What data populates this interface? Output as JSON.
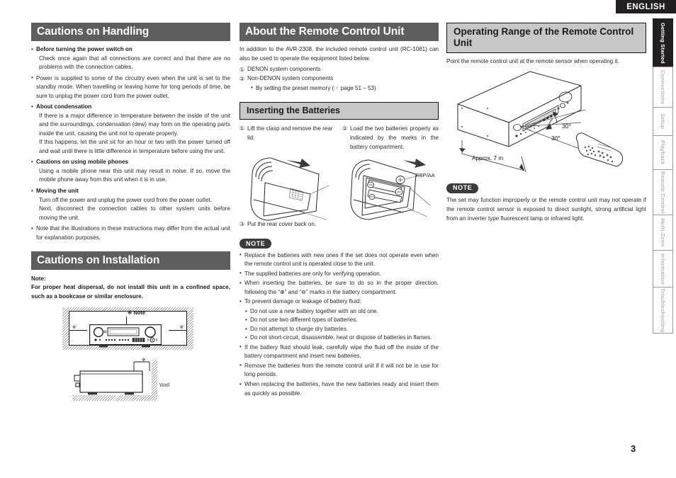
{
  "language_badge": "ENGLISH",
  "page_number": "3",
  "colors": {
    "heading_dark_bg": "#5e5e5e",
    "heading_gray_bg": "#c8c8c8",
    "note_pill_bg": "#3b3b3b",
    "active_tab_bg": "#231f20",
    "text": "#2b2b2b"
  },
  "left_column": {
    "handling": {
      "heading": "Cautions on Handling",
      "items": [
        {
          "bold": "Before turning the power switch on",
          "paras": [
            "Check once again that all connections are correct and that there are no problems with the connection cables."
          ]
        },
        {
          "bold": "",
          "paras": [
            "Power is supplied to some of the circuitry even when the unit is set to the standby mode. When travelling or leaving home for long periods of time, be sure to unplug the power cord from the power outlet."
          ]
        },
        {
          "bold": "About condensation",
          "paras": [
            "If there is a major difference in temperature between the inside of the unit and the surroundings, condensation (dew) may form on the operating parts inside the unit, causing the unit not to operate properly.",
            "If this happens, let the unit sit for an hour or two with the power turned off and wait until there is little difference in temperature before using the unit."
          ]
        },
        {
          "bold": "Cautions on using mobile phones",
          "paras": [
            "Using a mobile phone near this unit may result in noise. If so, move the mobile phone away from this unit when it is in use."
          ]
        },
        {
          "bold": "Moving the unit",
          "paras": [
            "Turn off the power and unplug the power cord from the power outlet.",
            "Next, disconnect the connection cables to other system units before moving the unit."
          ]
        },
        {
          "bold": "",
          "paras": [
            "Note that the illustrations in these instructions may differ from the actual unit for explanation purposes."
          ]
        }
      ]
    },
    "installation": {
      "heading": "Cautions on Installation",
      "note_label": "Note:",
      "note_text": "For proper heat dispersal, do not install this unit in a confined space, such as a bookcase or similar enclosure.",
      "figure": {
        "note_marker": "※ Note",
        "marker": "※",
        "wall_label": "Wall"
      }
    }
  },
  "middle_column": {
    "remote": {
      "heading": "About the Remote Control Unit",
      "intro": "In addition to the AVR-2308, the included remote control unit (RC-1081) can also be used to operate the equipment listed below.",
      "numbered": [
        {
          "num": "①",
          "text": "DENON system components"
        },
        {
          "num": "②",
          "text": "Non-DENON system components"
        }
      ],
      "sub_bullet": "By setting the preset memory (☞ page 51 – 53)"
    },
    "batteries": {
      "heading": "Inserting the Batteries",
      "step1_num": "①",
      "step1": "Lift the clasp and remove the rear lid.",
      "step2_num": "②",
      "step2": "Load the two batteries properly as indicated by the marks in the battery compartment.",
      "battery_label": "R6P/AA",
      "step3_num": "③",
      "step3": "Put the rear cover back on."
    },
    "note": {
      "label": "NOTE",
      "items": [
        "Replace the batteries with new ones if the set does not operate even when the remote control unit is operated close to the unit.",
        "The supplied batteries are only for verifying operation.",
        "When inserting the batteries, be sure to do so in the proper direction, following the “⊕” and “⊖” marks in the battery compartment.",
        "To prevent damage or leakage of battery fluid:"
      ],
      "sub_items": [
        "Do not use a new battery together with an old one.",
        "Do not use two different types of batteries.",
        "Do not attempt to charge dry batteries.",
        "Do not short-circuit, disassemble, heat or dispose of batteries in flames."
      ],
      "items_after": [
        "If the battery fluid should leak, carefully wipe the fluid off the inside of the battery compartment and insert new batteries.",
        "Remove the batteries from the remote control unit if it will not be in use for long periods.",
        "When replacing the batteries, have the new batteries ready and insert them as quickly as possible."
      ]
    }
  },
  "right_column": {
    "operating_range": {
      "heading": "Operating Range of the Remote Control Unit",
      "intro": "Point the remote control unit at the remote sensor when operating it.",
      "figure": {
        "angle_top": "30°",
        "angle_bottom": "30°",
        "distance": "Approx. 7 m"
      }
    },
    "note": {
      "label": "NOTE",
      "text": "The set may function improperly or the remote control unit may not operate if the remote control sensor is exposed to direct sunlight, strong artificial light from an inverter type fluorescent lamp or infrared light."
    }
  },
  "side_tabs": [
    {
      "label": "Getting Started",
      "active": true
    },
    {
      "label": "Connections",
      "active": false
    },
    {
      "label": "Setup",
      "active": false
    },
    {
      "label": "Playback",
      "active": false
    },
    {
      "label": "Remote Control",
      "active": false
    },
    {
      "label": "Multi-Zone",
      "active": false
    },
    {
      "label": "Information",
      "active": false
    },
    {
      "label": "Troubleshooting",
      "active": false
    }
  ]
}
